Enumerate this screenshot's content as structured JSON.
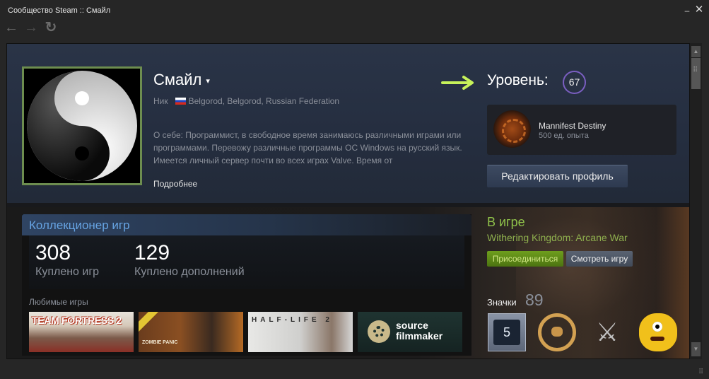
{
  "window": {
    "title": "Сообщество Steam :: Смайл",
    "minimize_icon": "minimize-icon",
    "close_icon": "close-icon",
    "nav": {
      "back_icon": "arrow-left-icon",
      "forward_icon": "arrow-right-icon",
      "reload_icon": "reload-icon"
    }
  },
  "profile": {
    "persona_name": "Смайл",
    "caret": "▾",
    "nick_label": "Ник",
    "location": "Belgorod, Belgorod, Russian Federation",
    "summary": "О себе: Программист, в свободное время занимаюсь различными играми или программами. Перевожу различные программы ОС Windows на русский язык. Имеется личный сервер почти во всех играх Valve. Время от",
    "more_link": "Подробнее",
    "level_label": "Уровень:",
    "level": "67",
    "favorite_badge": {
      "name": "Mannifest Destiny",
      "xp": "500 ед. опыта"
    },
    "edit_button": "Редактировать профиль"
  },
  "showcase": {
    "title": "Коллекционер игр",
    "stats": [
      {
        "value": "308",
        "label": "Куплено игр"
      },
      {
        "value": "129",
        "label": "Куплено дополнений"
      }
    ],
    "favorites_label": "Любимые игры",
    "games": [
      {
        "name": "TEAM FORTRESS 2"
      },
      {
        "name": "ZOMBIE PANIC"
      },
      {
        "name": "HALF-LIFE 2"
      },
      {
        "name": "source filmmaker"
      }
    ]
  },
  "status": {
    "state": "В игре",
    "game": "Withering Kingdom: Arcane War",
    "join_button": "Присоединиться",
    "view_button": "Смотреть игру"
  },
  "badges": {
    "label": "Значки",
    "count": "89",
    "items": [
      {
        "name": "years-of-service-badge",
        "value": "5"
      },
      {
        "name": "steering-wheel-badge"
      },
      {
        "name": "crossed-swords-badge",
        "glyph": "⚔"
      },
      {
        "name": "yellow-monster-badge"
      }
    ]
  },
  "scrollbar": {
    "up": "▲",
    "down": "▼"
  }
}
